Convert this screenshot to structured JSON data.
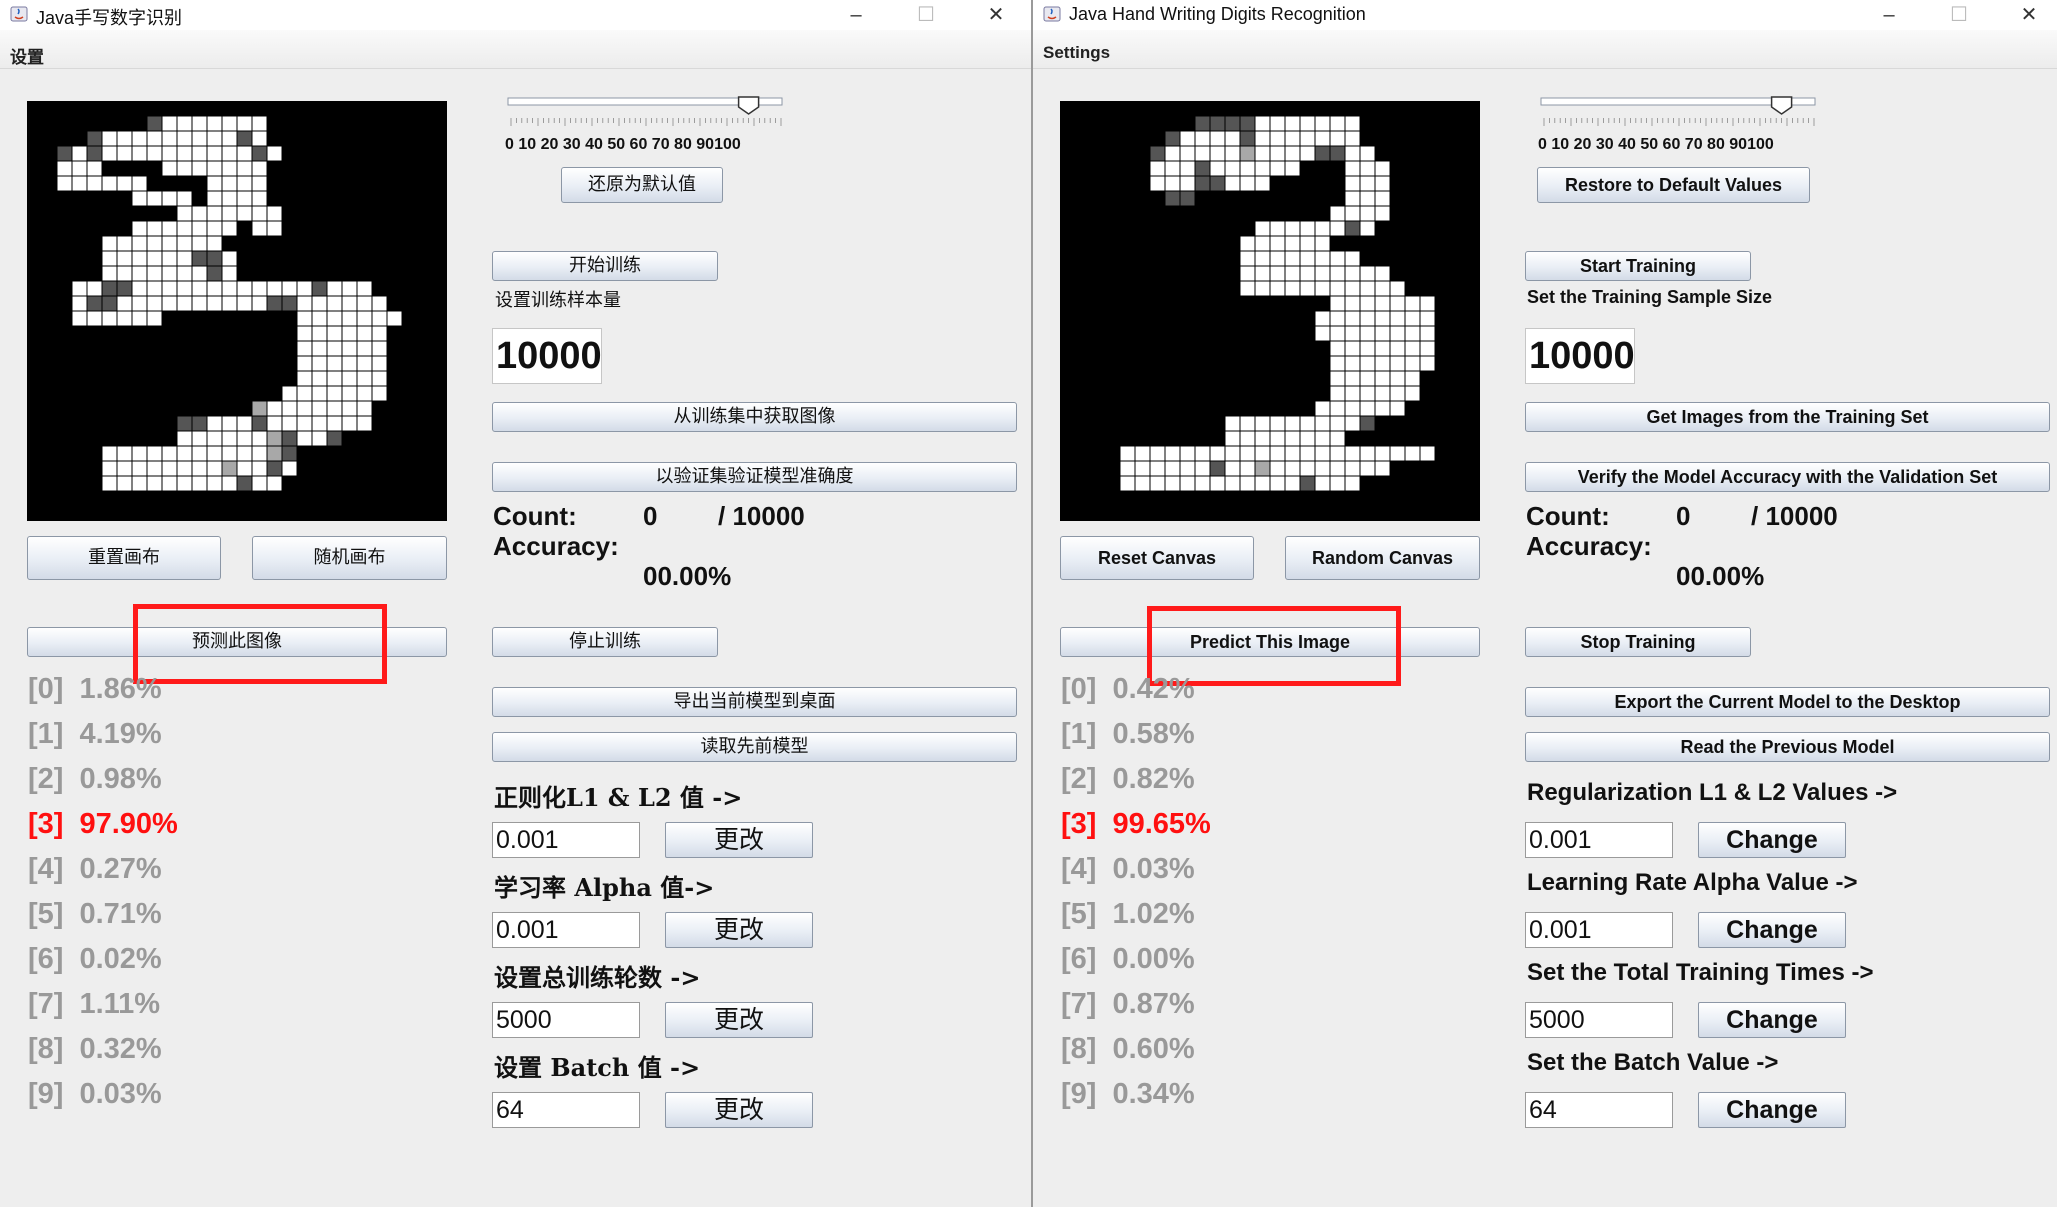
{
  "left": {
    "title": "Java手写数字识别",
    "menu": "设置",
    "slider_value": 0.88,
    "ticks": "0  10  20  30  40  50  60  70  80  90100",
    "restore_label": "还原为默认值",
    "reset_label": "重置画布",
    "random_label": "随机画布",
    "predict_label": "预测此图像",
    "start_label": "开始训练",
    "sample_size_label": "设置训练样本量",
    "sample_size_value": "10000",
    "get_images_label": "从训练集中获取图像",
    "verify_label": "以验证集验证模型准确度",
    "count_label": "Count:",
    "count_value": "0",
    "count_total": "/ 10000",
    "accuracy_label": "Accuracy:",
    "accuracy_value": "00.00%",
    "stop_label": "停止训练",
    "export_label": "导出当前模型到桌面",
    "read_label": "读取先前模型",
    "reg_label": "正则化L1 & L2 值 ->",
    "reg_value": "0.001",
    "lr_label": "学习率 Alpha 值->",
    "lr_value": "0.001",
    "epochs_label": "设置总训练轮数 ->",
    "epochs_value": "5000",
    "batch_label": "设置 Batch 值 ->",
    "batch_value": "64",
    "change_label": "更改",
    "probs": [
      {
        "d": "[0]",
        "p": "1.86%"
      },
      {
        "d": "[1]",
        "p": "4.19%"
      },
      {
        "d": "[2]",
        "p": "0.98%"
      },
      {
        "d": "[3]",
        "p": "97.90%"
      },
      {
        "d": "[4]",
        "p": "0.27%"
      },
      {
        "d": "[5]",
        "p": "0.71%"
      },
      {
        "d": "[6]",
        "p": "0.02%"
      },
      {
        "d": "[7]",
        "p": "1.11%"
      },
      {
        "d": "[8]",
        "p": "0.32%"
      },
      {
        "d": "[9]",
        "p": "0.03%"
      }
    ],
    "predicted_index": 3
  },
  "right": {
    "title": "Java Hand Writing Digits Recognition",
    "menu": "Settings",
    "slider_value": 0.88,
    "ticks": "0  10  20  30  40  50  60  70  80  90100",
    "restore_label": "Restore to Default Values",
    "reset_label": "Reset Canvas",
    "random_label": "Random Canvas",
    "predict_label": "Predict This Image",
    "start_label": "Start Training",
    "sample_size_label": "Set the Training Sample Size",
    "sample_size_value": "10000",
    "get_images_label": "Get Images from the Training Set",
    "verify_label": "Verify the Model Accuracy with the Validation Set",
    "count_label": "Count:",
    "count_value": "0",
    "count_total": "/ 10000",
    "accuracy_label": "Accuracy:",
    "accuracy_value": "00.00%",
    "stop_label": "Stop Training",
    "export_label": "Export the Current Model to the Desktop",
    "read_label": "Read the Previous Model",
    "reg_label": "Regularization L1 & L2 Values ->",
    "reg_value": "0.001",
    "lr_label": "Learning Rate Alpha Value ->",
    "lr_value": "0.001",
    "epochs_label": "Set the Total Training Times ->",
    "epochs_value": "5000",
    "batch_label": "Set the Batch Value ->",
    "batch_value": "64",
    "change_label": "Change",
    "probs": [
      {
        "d": "[0]",
        "p": "0.42%"
      },
      {
        "d": "[1]",
        "p": "0.58%"
      },
      {
        "d": "[2]",
        "p": "0.82%"
      },
      {
        "d": "[3]",
        "p": "99.65%"
      },
      {
        "d": "[4]",
        "p": "0.03%"
      },
      {
        "d": "[5]",
        "p": "1.02%"
      },
      {
        "d": "[6]",
        "p": "0.00%"
      },
      {
        "d": "[7]",
        "p": "0.87%"
      },
      {
        "d": "[8]",
        "p": "0.60%"
      },
      {
        "d": "[9]",
        "p": "0.34%"
      }
    ],
    "predicted_index": 3
  },
  "colors": {
    "highlight_box": "#ff1a1a",
    "predicted_text": "#ff1010",
    "probability_text": "#999999"
  },
  "icons": [
    "java-app-icon",
    "minimize-icon",
    "maximize-icon",
    "close-icon"
  ]
}
